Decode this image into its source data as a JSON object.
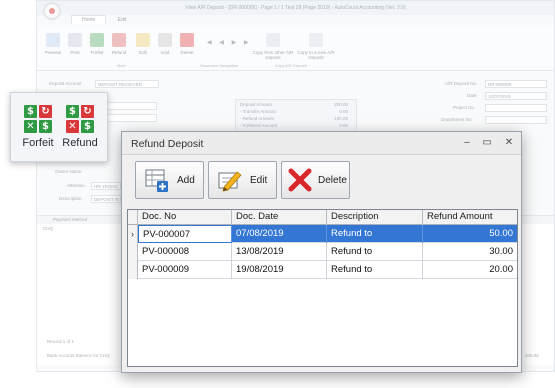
{
  "background_app": {
    "title": "View A/R Deposit - [DR-000008] - Page 1 / 1 Test 28 (Page 2019) - AutoCount Accounting (Ver. 2.0)",
    "tabs": [
      "Home",
      "Edit"
    ],
    "ribbon": {
      "buttons": [
        "Preview",
        "Print",
        "Forfeit",
        "Refund",
        "Edit",
        "Void",
        "Delete",
        "Copy from other A/R Deposit",
        "Copy to a new A/R Deposit"
      ],
      "groups": [
        "Main",
        "Document Navigation",
        "Copy A/R Deposit"
      ],
      "nav_arrows": "◀ ◀ ▶ ▶"
    },
    "form": {
      "deposit_account_label": "Deposit Account",
      "deposit_account_value": "DEPOSIT RECEIVED",
      "debtor_label": "Debtor",
      "deposit_no_label": "A/R Deposit No",
      "deposit_no_value": "DR-000008",
      "date_label": "Date",
      "date_value": "12/07/2019",
      "project_label": "Project No",
      "department_label": "Department No",
      "summary": [
        {
          "label": "Deposit Amount",
          "value": "200.00"
        },
        {
          "label": "- Transfer Amount",
          "value": "0.00"
        },
        {
          "label": "- Refund Amount",
          "value": "100.00"
        },
        {
          "label": "- Forfeited Amount",
          "value": "0.00"
        }
      ],
      "owner_name_label": "Owner Name",
      "phone_label": "Attention",
      "phone_value": "HR,YEONG",
      "desc_label": "Description",
      "desc_value": "DEPOSIT IN",
      "grid_header": "Payment Method",
      "grid_row": "CHQ",
      "record_text": "Record 1 of 1",
      "balance_text": "Bank Account Balance for CHQ",
      "total_value": "200.00"
    }
  },
  "zoom_callout": {
    "buttons": [
      {
        "label": "Forfeit"
      },
      {
        "label": "Refund"
      }
    ]
  },
  "dialog": {
    "title": "Refund Deposit",
    "controls": {
      "minimize": "–",
      "maximize": "▭",
      "close": "✕"
    },
    "toolbar": {
      "add_label": "Add",
      "edit_label": "Edit",
      "delete_label": "Delete"
    },
    "grid": {
      "columns": [
        "Doc. No",
        "Doc. Date",
        "Description",
        "Refund Amount"
      ],
      "rows": [
        {
          "doc_no": "PV-000007",
          "doc_date": "07/08/2019",
          "description": "Refund to",
          "amount": "50.00"
        },
        {
          "doc_no": "PV-000008",
          "doc_date": "13/08/2019",
          "description": "Refund to",
          "amount": "30.00"
        },
        {
          "doc_no": "PV-000009",
          "doc_date": "19/08/2019",
          "description": "Refund to",
          "amount": "20.00"
        }
      ],
      "row_indicator": "›"
    }
  },
  "colors": {
    "selection": "#3476d3",
    "forfeit_green": "#2f9a43",
    "refund_red": "#d9383a"
  }
}
